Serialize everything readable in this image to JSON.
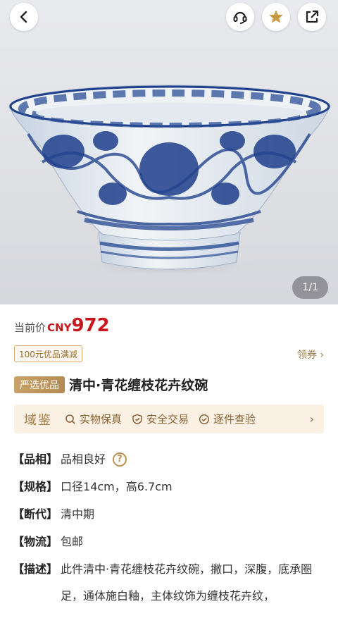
{
  "gallery": {
    "counter": "1/1"
  },
  "colors": {
    "price": "#c8161d",
    "gold": "#b38a52",
    "trust_bg": "#faf1e4"
  },
  "price": {
    "label": "当前价",
    "currency": "CNY",
    "value": "972"
  },
  "coupon": {
    "tag": "100元优品满减",
    "action": "领券 ›"
  },
  "product": {
    "badge": "严选优品",
    "title": "清中·青花缠枝花卉纹碗"
  },
  "trust": {
    "logo": "域鉴",
    "items": [
      {
        "icon": "search-icon",
        "label": "实物保真"
      },
      {
        "icon": "shield-icon",
        "label": "安全交易"
      },
      {
        "icon": "check-circle-icon",
        "label": "逐件查验"
      }
    ]
  },
  "specs": [
    {
      "key": "【品相】",
      "value": "品相良好"
    },
    {
      "key": "【规格】",
      "value": "口径14cm，高6.7cm"
    },
    {
      "key": "【断代】",
      "value": "清中期"
    },
    {
      "key": "【物流】",
      "value": "包邮"
    },
    {
      "key": "【描述】",
      "value": "此件清中·青花缠枝花卉纹碗，撇口，深腹，底承圈足，通体施白釉，主体纹饰为缠枝花卉纹，"
    }
  ]
}
